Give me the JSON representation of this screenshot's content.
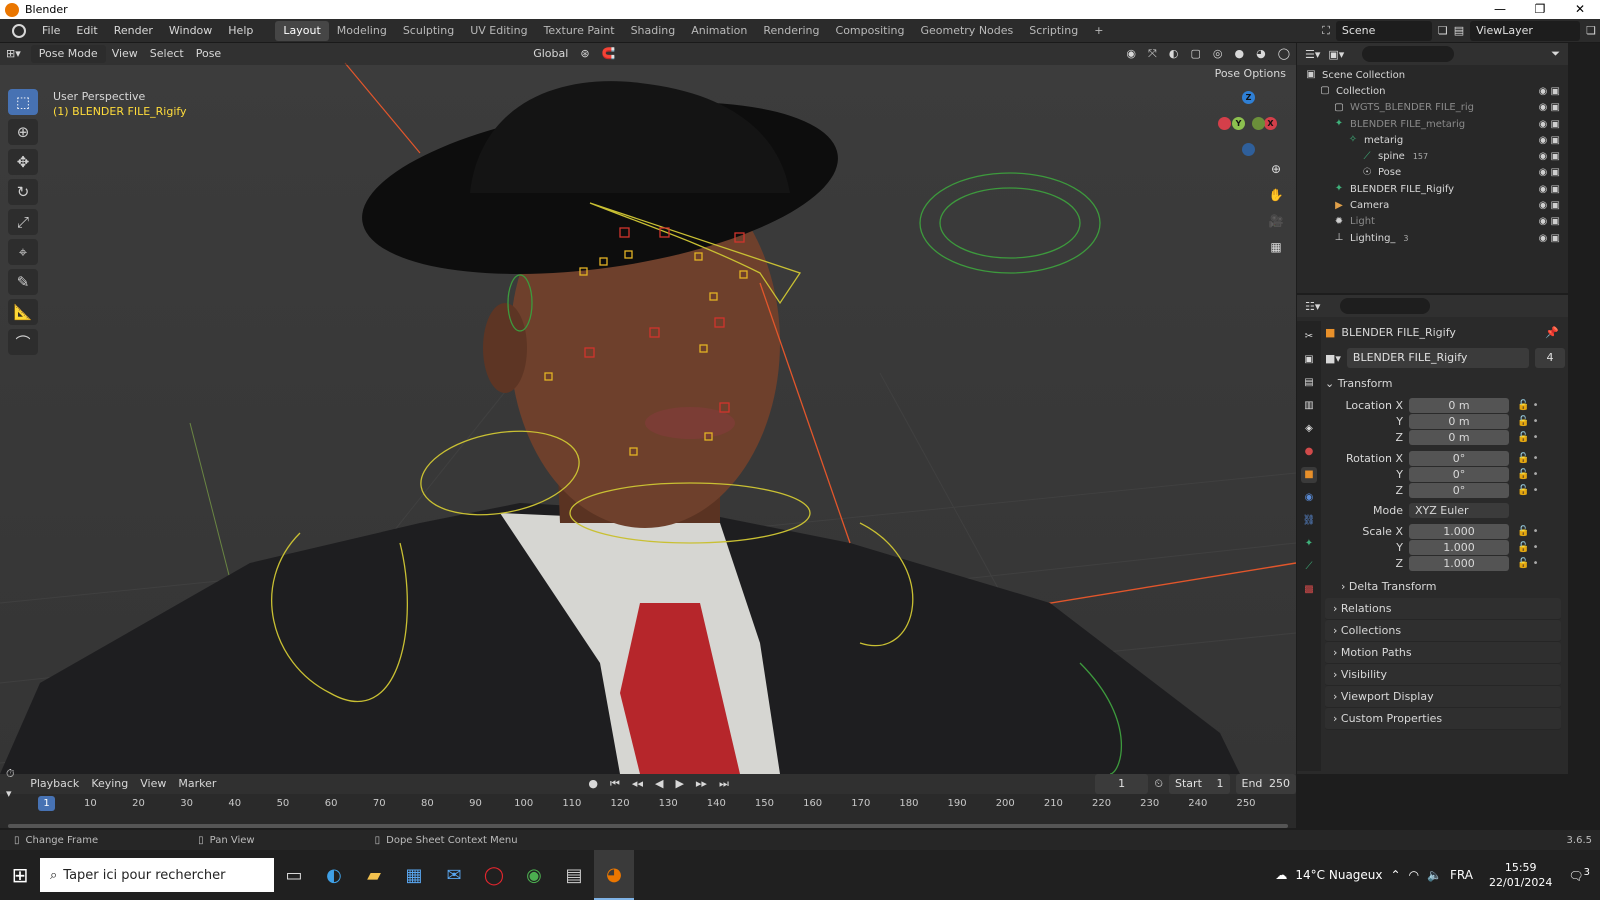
{
  "window": {
    "title": "Blender",
    "controls": [
      "—",
      "❐",
      "✕"
    ]
  },
  "menubar": {
    "menus": [
      "File",
      "Edit",
      "Render",
      "Window",
      "Help"
    ],
    "workspaces": [
      "Layout",
      "Modeling",
      "Sculpting",
      "UV Editing",
      "Texture Paint",
      "Shading",
      "Animation",
      "Rendering",
      "Compositing",
      "Geometry Nodes",
      "Scripting",
      "+"
    ],
    "active_workspace": "Layout",
    "scene": "Scene",
    "view_layer": "ViewLayer"
  },
  "viewport": {
    "mode": "Pose Mode",
    "menus": [
      "View",
      "Select",
      "Pose"
    ],
    "orientation": "Global",
    "pose_options": "Pose Options",
    "info_line1": "User Perspective",
    "info_line2": "(1) BLENDER FILE_Rigify",
    "axes": {
      "x": "X",
      "y": "Y",
      "z": "Z"
    },
    "tools": [
      "select-box",
      "cursor",
      "move",
      "rotate",
      "scale",
      "transform",
      "annotate",
      "measure",
      "bone-pose"
    ]
  },
  "outliner": {
    "rows": [
      {
        "label": "Scene Collection",
        "indent": 0,
        "icon": "scene-collection-icon",
        "dim": false,
        "badge": ""
      },
      {
        "label": "Collection",
        "indent": 1,
        "icon": "collection-icon",
        "dim": false,
        "badge": ""
      },
      {
        "label": "WGTS_BLENDER FILE_rig",
        "indent": 2,
        "icon": "collection-icon",
        "dim": true,
        "badge": ""
      },
      {
        "label": "BLENDER FILE_metarig",
        "indent": 2,
        "icon": "armature-icon",
        "dim": true,
        "badge": ""
      },
      {
        "label": "metarig",
        "indent": 3,
        "icon": "armature-data-icon",
        "dim": false,
        "badge": ""
      },
      {
        "label": "spine",
        "indent": 4,
        "icon": "bone-icon",
        "dim": false,
        "badge": "157"
      },
      {
        "label": "Pose",
        "indent": 4,
        "icon": "pose-icon",
        "dim": false,
        "badge": ""
      },
      {
        "label": "BLENDER FILE_Rigify",
        "indent": 2,
        "icon": "armature-icon",
        "dim": false,
        "badge": ""
      },
      {
        "label": "Camera",
        "indent": 2,
        "icon": "camera-icon",
        "dim": false,
        "badge": ""
      },
      {
        "label": "Light",
        "indent": 2,
        "icon": "light-icon",
        "dim": true,
        "badge": ""
      },
      {
        "label": "Lighting_",
        "indent": 2,
        "icon": "empty-icon",
        "dim": false,
        "badge": "3"
      }
    ]
  },
  "properties": {
    "object_name": "BLENDER FILE_Rigify",
    "data_name": "BLENDER FILE_Rigify",
    "users": "4",
    "transform_label": "Transform",
    "location": [
      {
        "label": "Location X",
        "value": "0 m"
      },
      {
        "label": "Y",
        "value": "0 m"
      },
      {
        "label": "Z",
        "value": "0 m"
      }
    ],
    "rotation": [
      {
        "label": "Rotation X",
        "value": "0°"
      },
      {
        "label": "Y",
        "value": "0°"
      },
      {
        "label": "Z",
        "value": "0°"
      }
    ],
    "mode_label": "Mode",
    "mode_value": "XYZ Euler",
    "scale": [
      {
        "label": "Scale X",
        "value": "1.000"
      },
      {
        "label": "Y",
        "value": "1.000"
      },
      {
        "label": "Z",
        "value": "1.000"
      }
    ],
    "delta": "Delta Transform",
    "panels": [
      "Relations",
      "Collections",
      "Motion Paths",
      "Visibility",
      "Viewport Display",
      "Custom Properties"
    ]
  },
  "timeline": {
    "menus": [
      "Playback",
      "Keying",
      "View",
      "Marker"
    ],
    "current_frame": "1",
    "start_label": "Start",
    "start": "1",
    "end_label": "End",
    "end": "250",
    "ticks": [
      "10",
      "20",
      "30",
      "40",
      "50",
      "60",
      "70",
      "80",
      "90",
      "100",
      "110",
      "120",
      "130",
      "140",
      "150",
      "160",
      "170",
      "180",
      "190",
      "200",
      "210",
      "220",
      "230",
      "240",
      "250"
    ]
  },
  "statusbar": {
    "hints": [
      "Change Frame",
      "Pan View",
      "Dope Sheet Context Menu"
    ],
    "version": "3.6.5"
  },
  "taskbar": {
    "search_placeholder": "Taper ici pour rechercher",
    "weather": "14°C Nuageux",
    "language": "FRA",
    "time": "15:59",
    "date": "22/01/2024",
    "notifications": "3"
  },
  "colors": {
    "accent": "#4772b3",
    "selected_text": "#ffdc3b",
    "blender_orange": "#ea7600"
  }
}
